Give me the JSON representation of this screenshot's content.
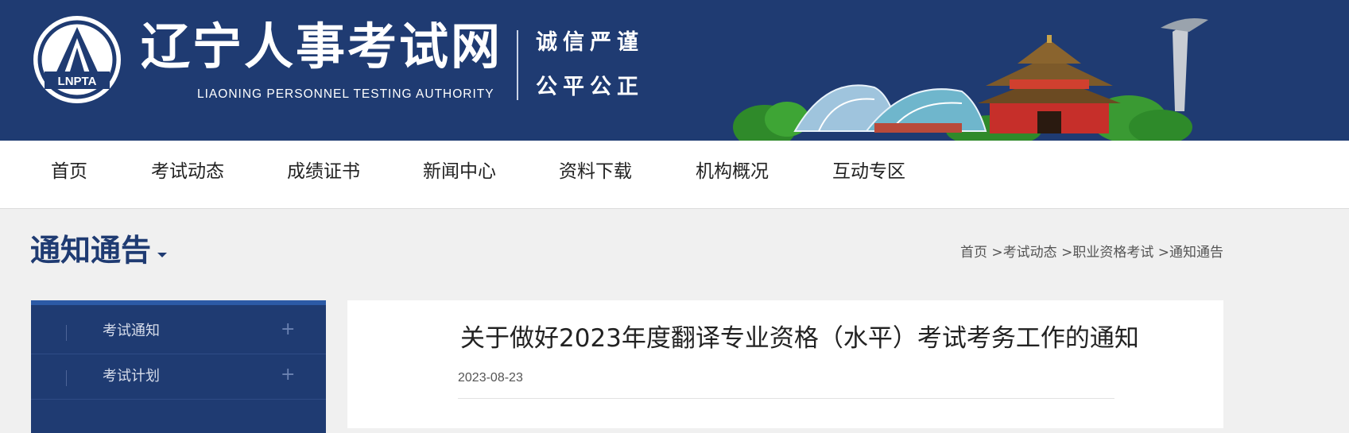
{
  "header": {
    "logo_text": "LNPTA",
    "title": "辽宁人事考试网",
    "subtitle": "LIAONING PERSONNEL TESTING AUTHORITY",
    "motto_line1": "诚信严谨",
    "motto_line2": "公平公正",
    "bg_color": "#1f3b72"
  },
  "nav": {
    "items": [
      "首页",
      "考试动态",
      "成绩证书",
      "新闻中心",
      "资料下载",
      "机构概况",
      "互动专区"
    ]
  },
  "section": {
    "title": "通知通告",
    "breadcrumb": [
      "首页",
      "考试动态",
      "职业资格考试",
      "通知通告"
    ]
  },
  "sidebar": {
    "items": [
      {
        "label": "考试通知",
        "icon": "plus-icon"
      },
      {
        "label": "考试计划",
        "icon": "plus-icon"
      }
    ]
  },
  "article": {
    "title": "关于做好2023年度翻译专业资格（水平）考试考务工作的通知",
    "date": "2023-08-23"
  },
  "colors": {
    "accent": "#1f3b72",
    "sidebar_top": "#2c5aa6"
  }
}
